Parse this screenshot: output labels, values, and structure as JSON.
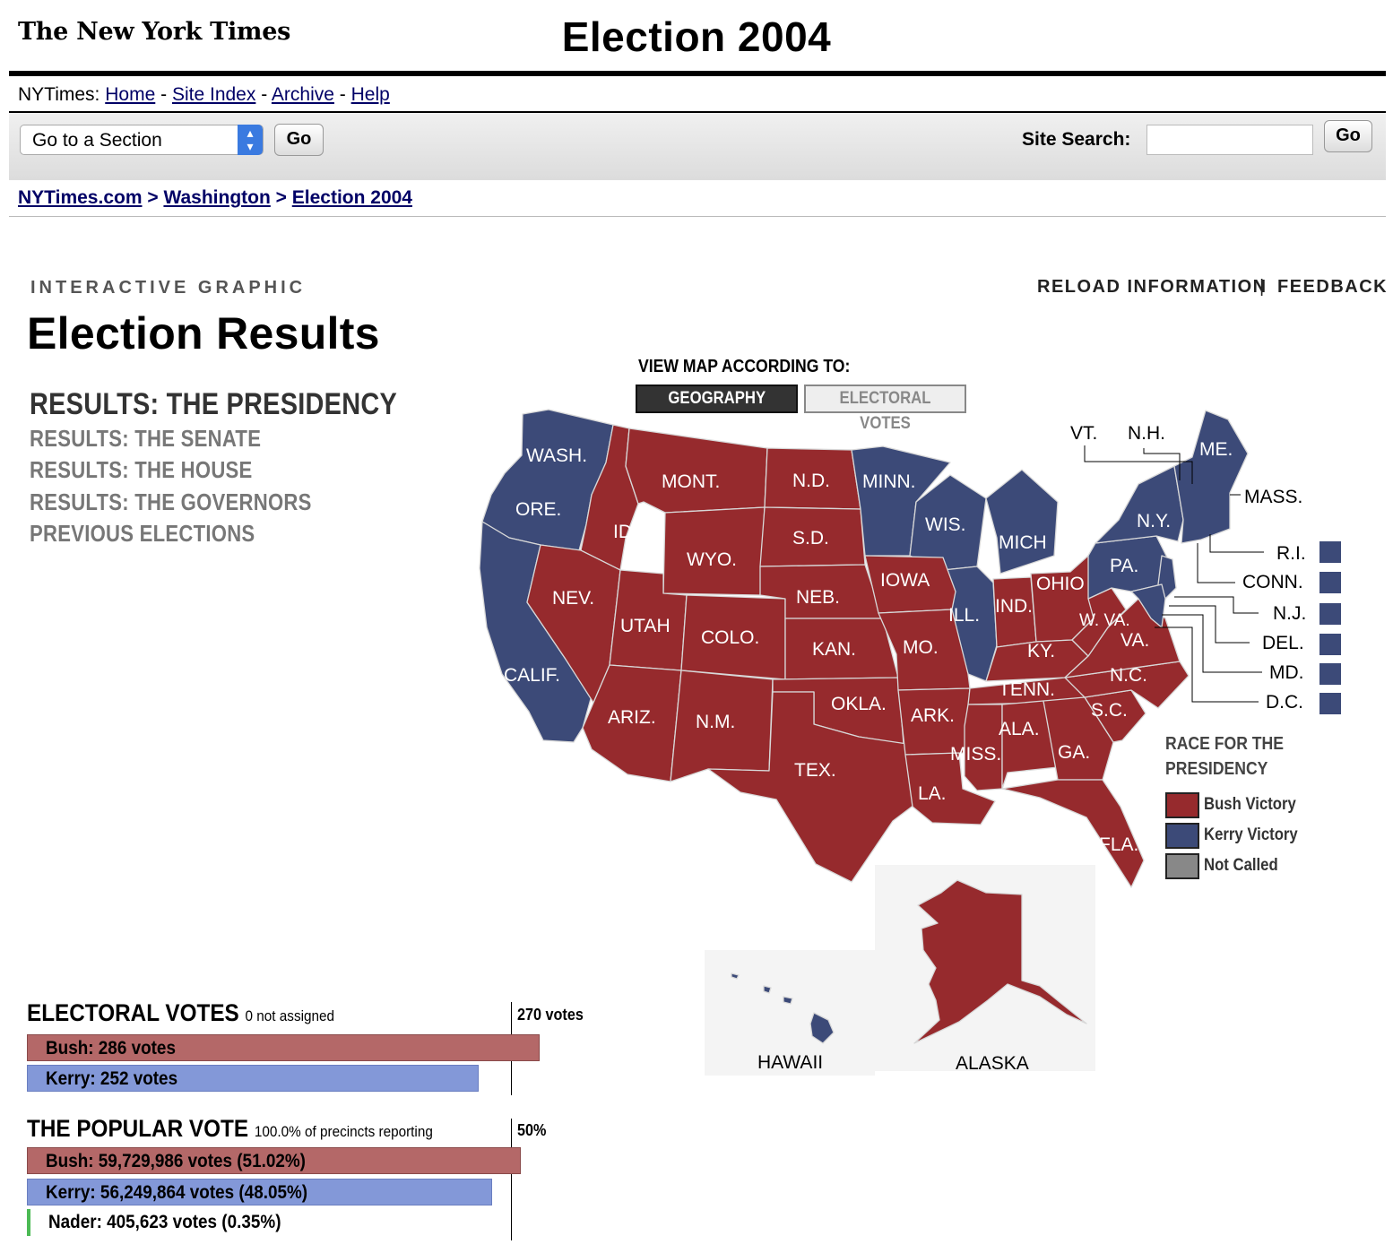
{
  "header": {
    "logo": "The New York Times",
    "masthead": "Election 2004"
  },
  "nav": {
    "prefix": "NYTimes:",
    "links": [
      "Home",
      "Site Index",
      "Archive",
      "Help"
    ],
    "sep": "-"
  },
  "toolbar": {
    "section_select": "Go to a Section",
    "go_label": "Go",
    "search_label": "Site Search:",
    "search_value": "",
    "search_go_label": "Go"
  },
  "breadcrumb": [
    "NYTimes.com",
    "Washington",
    "Election 2004"
  ],
  "page": {
    "kicker": "INTERACTIVE GRAPHIC",
    "title": "Election Results",
    "reload": "RELOAD INFORMATION",
    "feedback": "FEEDBACK",
    "divider": "|"
  },
  "sections": [
    {
      "label": "RESULTS: THE PRESIDENCY",
      "active": true
    },
    {
      "label": "RESULTS: THE SENATE",
      "active": false
    },
    {
      "label": "RESULTS: THE HOUSE",
      "active": false
    },
    {
      "label": "RESULTS: THE GOVERNORS",
      "active": false
    },
    {
      "label": "PREVIOUS ELECTIONS",
      "active": false
    }
  ],
  "map_view": {
    "label": "VIEW MAP ACCORDING TO:",
    "options": [
      "GEOGRAPHY",
      "ELECTORAL VOTES"
    ],
    "selected": "GEOGRAPHY"
  },
  "colors": {
    "bush": "#962a2d",
    "kerry": "#3c4a78",
    "not_called": "#888888",
    "bush_bar": "#b46868",
    "kerry_bar": "#8398d8",
    "nader_bar": "#4cba54"
  },
  "map": {
    "state_labels": [
      "WASH.",
      "ORE.",
      "CALIF.",
      "NEV.",
      "ID.",
      "MONT.",
      "WYO.",
      "UTAH",
      "COLO.",
      "ARIZ.",
      "N.M.",
      "N.D.",
      "S.D.",
      "NEB.",
      "KAN.",
      "OKLA.",
      "TEX.",
      "MINN.",
      "IOWA",
      "MO.",
      "ARK.",
      "LA.",
      "WIS.",
      "ILL.",
      "MICH",
      "IND.",
      "OHIO",
      "KY.",
      "TENN.",
      "MISS.",
      "ALA.",
      "GA.",
      "FLA.",
      "S.C.",
      "N.C.",
      "VA.",
      "W. VA.",
      "PA.",
      "N.Y.",
      "ME."
    ],
    "callouts": [
      "VT.",
      "N.H.",
      "MASS.",
      "R.I.",
      "CONN.",
      "N.J.",
      "DEL.",
      "MD.",
      "D.C."
    ],
    "insets": [
      "HAWAII",
      "ALASKA"
    ]
  },
  "legend": {
    "title_line1": "RACE FOR THE",
    "title_line2": "PRESIDENCY",
    "items": [
      {
        "label": "Bush Victory",
        "color": "#962a2d"
      },
      {
        "label": "Kerry Victory",
        "color": "#3c4a78"
      },
      {
        "label": "Not Called",
        "color": "#888888"
      }
    ]
  },
  "electoral": {
    "heading": "ELECTORAL VOTES",
    "note": "0 not assigned",
    "threshold_label": "270 votes",
    "bars": [
      {
        "label": "Bush: 286 votes",
        "value": 286
      },
      {
        "label": "Kerry: 252 votes",
        "value": 252
      }
    ]
  },
  "popular": {
    "heading": "THE POPULAR VOTE",
    "note": "100.0% of precincts reporting",
    "threshold_label": "50%",
    "bars": [
      {
        "label": "Bush: 59,729,986 votes (51.02%)",
        "percent": 51.02
      },
      {
        "label": "Kerry: 56,249,864 votes (48.05%)",
        "percent": 48.05
      },
      {
        "label": "Nader: 405,623 votes (0.35%)",
        "percent": 0.35
      }
    ]
  }
}
